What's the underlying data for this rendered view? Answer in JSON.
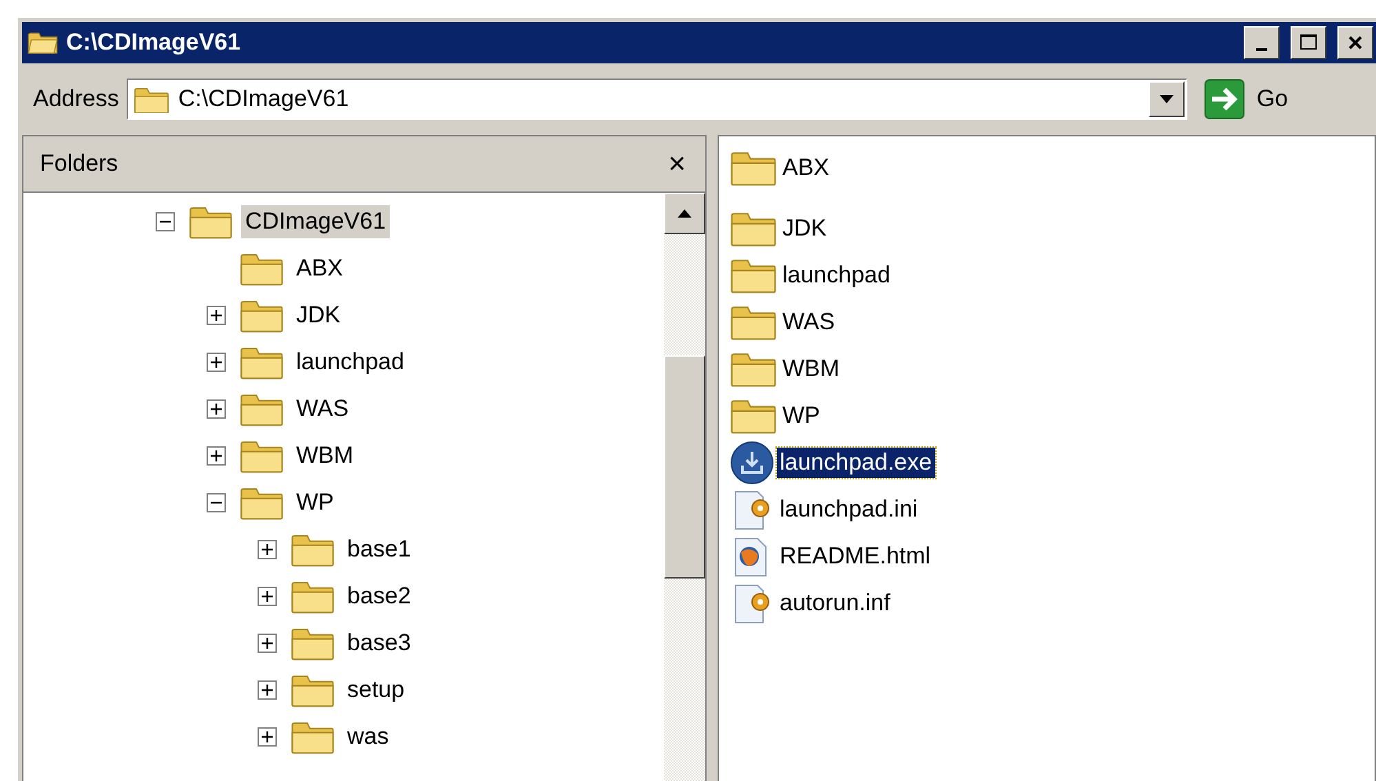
{
  "window": {
    "title": "C:\\CDImageV61"
  },
  "address": {
    "label": "Address",
    "value": "C:\\CDImageV61",
    "go": "Go"
  },
  "folders_pane": {
    "title": "Folders",
    "close": "×"
  },
  "tree": [
    {
      "label": "CDImageV61",
      "kind": "expanded",
      "selected": true,
      "children": [
        {
          "label": "ABX",
          "kind": "leaf",
          "selected": false
        },
        {
          "label": "JDK",
          "kind": "collapsed",
          "selected": false
        },
        {
          "label": "launchpad",
          "kind": "collapsed",
          "selected": false
        },
        {
          "label": "WAS",
          "kind": "collapsed",
          "selected": false
        },
        {
          "label": "WBM",
          "kind": "collapsed",
          "selected": false
        },
        {
          "label": "WP",
          "kind": "expanded",
          "selected": false,
          "children": [
            {
              "label": "base1",
              "kind": "collapsed",
              "selected": false
            },
            {
              "label": "base2",
              "kind": "collapsed",
              "selected": false
            },
            {
              "label": "base3",
              "kind": "collapsed",
              "selected": false
            },
            {
              "label": "setup",
              "kind": "collapsed",
              "selected": false
            },
            {
              "label": "was",
              "kind": "collapsed",
              "selected": false
            }
          ]
        }
      ]
    }
  ],
  "files": [
    {
      "name": "ABX",
      "kind": "folder",
      "selected": false
    },
    {
      "name": "JDK",
      "kind": "folder",
      "selected": false
    },
    {
      "name": "launchpad",
      "kind": "folder",
      "selected": false
    },
    {
      "name": "WAS",
      "kind": "folder",
      "selected": false
    },
    {
      "name": "WBM",
      "kind": "folder",
      "selected": false
    },
    {
      "name": "WP",
      "kind": "folder",
      "selected": false
    },
    {
      "name": "launchpad.exe",
      "kind": "exe",
      "selected": true
    },
    {
      "name": "launchpad.ini",
      "kind": "config",
      "selected": false
    },
    {
      "name": "README.html",
      "kind": "html",
      "selected": false
    },
    {
      "name": "autorun.inf",
      "kind": "config",
      "selected": false
    }
  ]
}
